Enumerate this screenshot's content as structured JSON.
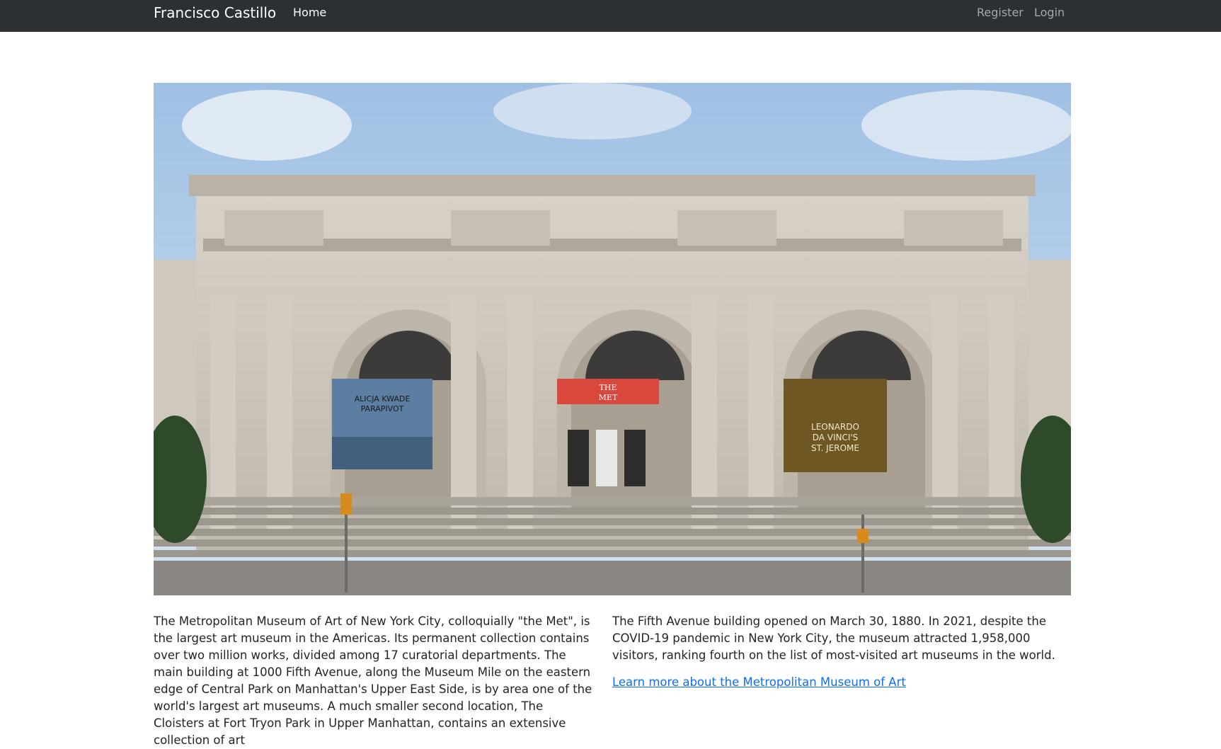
{
  "navbar": {
    "brand": "Francisco Castillo",
    "home": "Home",
    "register": "Register",
    "login": "Login"
  },
  "hero": {
    "banner_left": [
      "ALICJA KWADE",
      "PARAPIVOT"
    ],
    "banner_center": [
      "THE",
      "MET"
    ],
    "banner_right": [
      "LEONARDO",
      "DA VINCI'S",
      "ST. JEROME"
    ]
  },
  "content": {
    "left_paragraph": "The Metropolitan Museum of Art of New York City, colloquially \"the Met\", is the largest art museum in the Americas. Its permanent collection contains over two million works, divided among 17 curatorial departments. The main building at 1000 Fifth Avenue, along the Museum Mile on the eastern edge of Central Park on Manhattan's Upper East Side, is by area one of the world's largest art museums. A much smaller second location, The Cloisters at Fort Tryon Park in Upper Manhattan, contains an extensive collection of art",
    "right_paragraph": "The Fifth Avenue building opened on March 30, 1880. In 2021, despite the COVID-19 pandemic in New York City, the museum attracted 1,958,000 visitors, ranking fourth on the list of most-visited art museums in the world.",
    "learn_more": "Learn more about the Metropolitan Museum of Art"
  }
}
